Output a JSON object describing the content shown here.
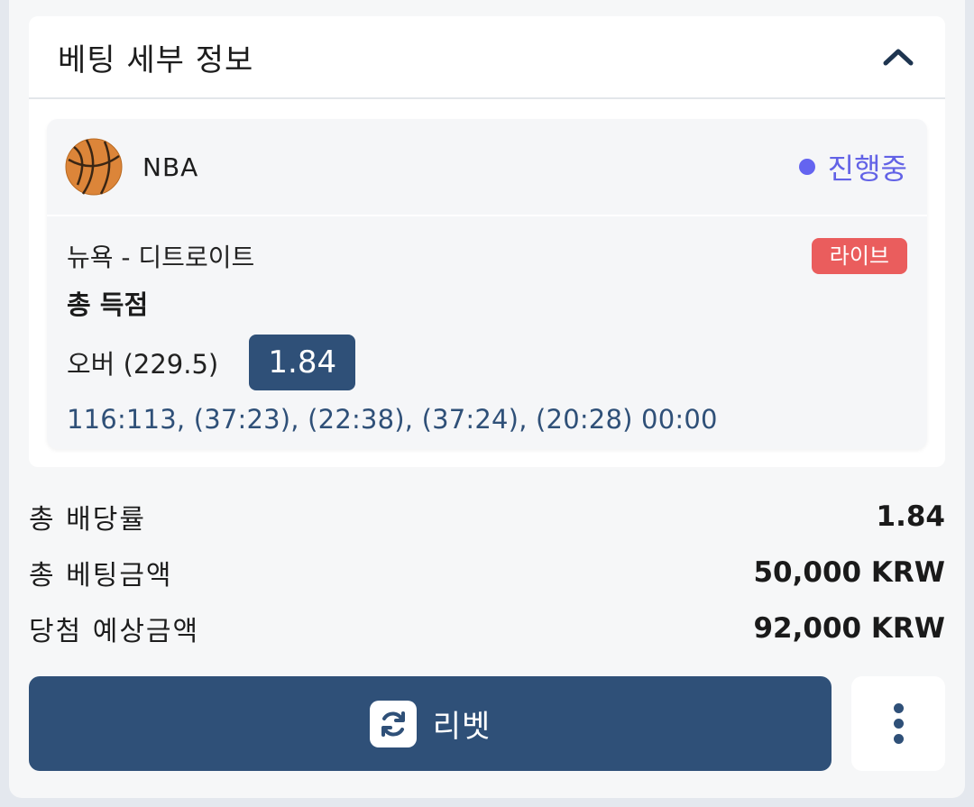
{
  "header": {
    "title": "베팅 세부 정보",
    "collapse_icon": "chevron-up-icon"
  },
  "bet": {
    "league_icon": "basketball-icon",
    "league": "NBA",
    "status": "진행중",
    "status_color": "#6464f0",
    "match": "뉴욕 - 디트로이트",
    "badge": "라이브",
    "badge_color": "#ea5d5d",
    "market": "총 득점",
    "pick": "오버 (229.5)",
    "odds": "1.84",
    "score": "116:113, (37:23), (22:38), (37:24), (20:28) 00:00"
  },
  "summary": [
    {
      "label": "총 배당률",
      "value": "1.84"
    },
    {
      "label": "총 베팅금액",
      "value": "50,000 KRW"
    },
    {
      "label": "당첨 예상금액",
      "value": "92,000 KRW"
    }
  ],
  "actions": {
    "rebet_label": "리벳",
    "rebet_icon": "refresh-icon",
    "more_icon": "more-vertical-icon"
  },
  "colors": {
    "primary": "#2f5078",
    "accent": "#6464f0",
    "live": "#ea5d5d"
  }
}
